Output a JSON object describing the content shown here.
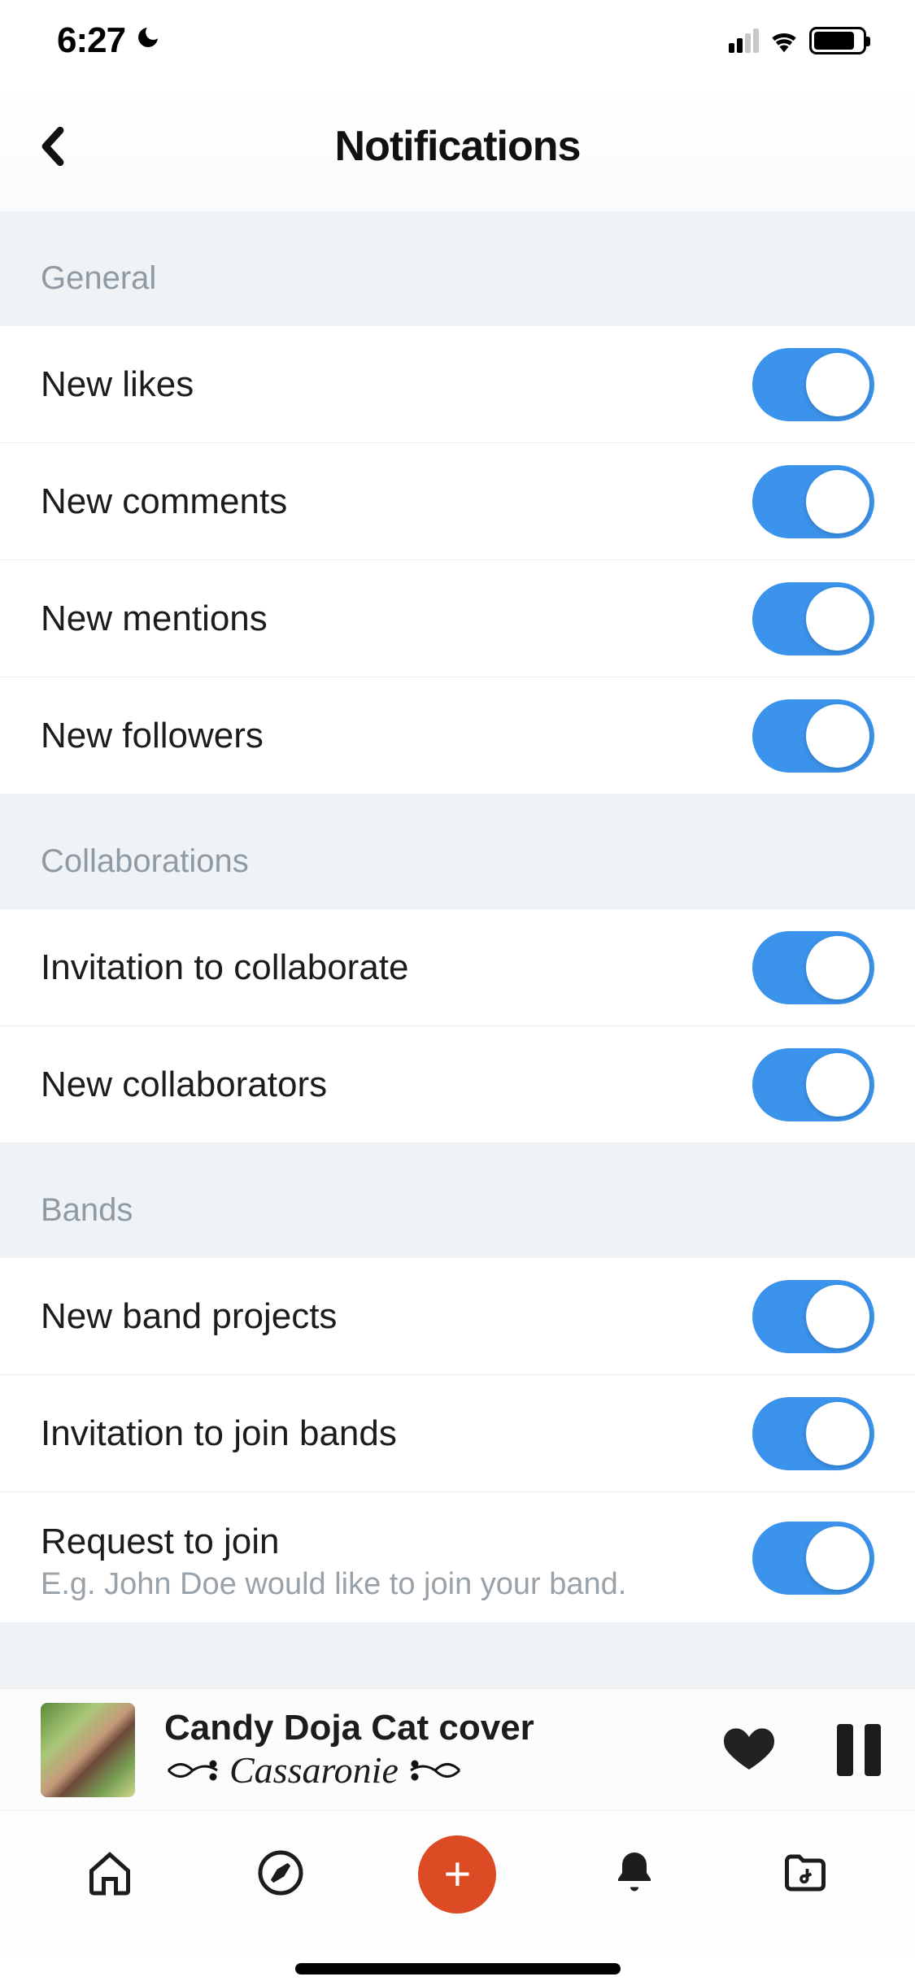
{
  "status": {
    "time": "6:27"
  },
  "header": {
    "title": "Notifications"
  },
  "sections": [
    {
      "title": "General",
      "rows": [
        {
          "label": "New likes",
          "on": true
        },
        {
          "label": "New comments",
          "on": true
        },
        {
          "label": "New mentions",
          "on": true
        },
        {
          "label": "New followers",
          "on": true
        }
      ]
    },
    {
      "title": "Collaborations",
      "rows": [
        {
          "label": "Invitation to collaborate",
          "on": true
        },
        {
          "label": "New collaborators",
          "on": true
        }
      ]
    },
    {
      "title": "Bands",
      "rows": [
        {
          "label": "New band projects",
          "on": true
        },
        {
          "label": "Invitation to join bands",
          "on": true
        },
        {
          "label": "Request to join",
          "sub": "E.g. John Doe would like to join your band.",
          "on": true
        }
      ]
    }
  ],
  "now_playing": {
    "title": "Candy Doja Cat cover",
    "artist": "Cassaronie"
  }
}
